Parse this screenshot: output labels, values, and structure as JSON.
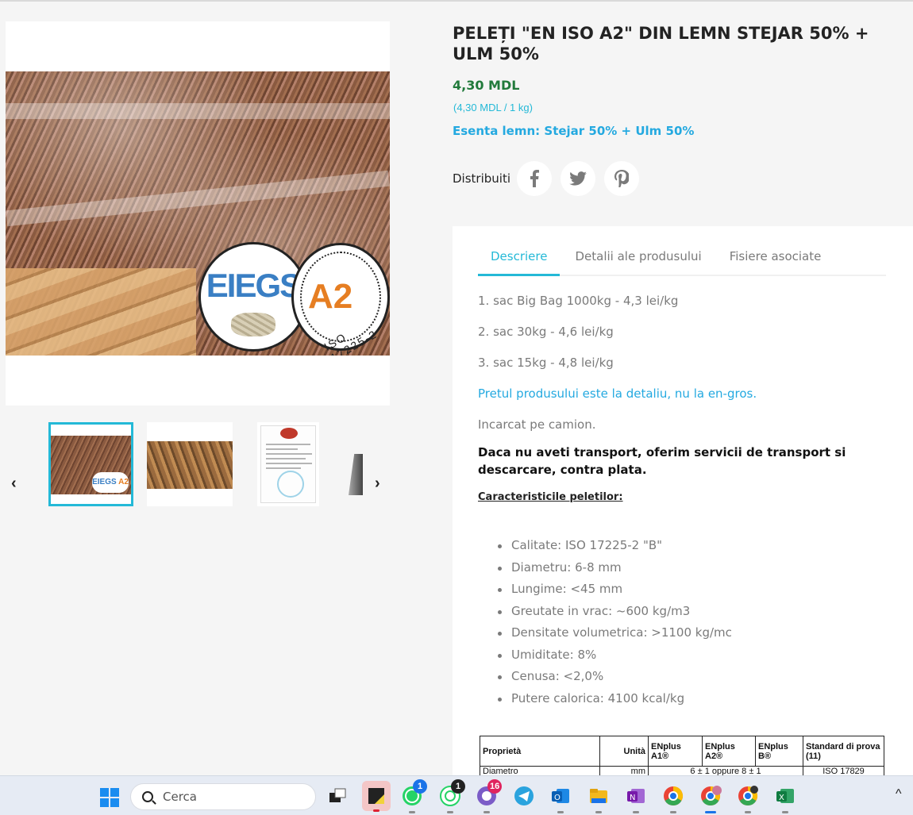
{
  "product": {
    "title": "PELEȚI \"EN ISO A2\" DIN LEMN STEJAR 50% + ULM 50%",
    "price": "4,30 MDL",
    "unit_price": "(4,30 MDL / 1 kg)",
    "wood_essence": "Esenta lemn: Stejar 50% + Ulm 50%"
  },
  "image": {
    "seal_left_text": "EIEGS",
    "seal_right_text": "A2",
    "seal_right_iso": "ISO 17225-2",
    "thumb_seal_left": "EIEGS",
    "thumb_seal_right": "A2"
  },
  "share": {
    "label": "Distribuiti",
    "icons": [
      "facebook-icon",
      "twitter-icon",
      "pinterest-icon"
    ]
  },
  "tabs": [
    {
      "label": "Descriere",
      "active": true
    },
    {
      "label": "Detalii ale produsului",
      "active": false
    },
    {
      "label": "Fisiere asociate",
      "active": false
    }
  ],
  "description": {
    "lines": [
      "1. sac Big Bag 1000kg - 4,3 lei/kg",
      "2. sac 30kg - 4,6 lei/kg",
      "3. sac 15kg - 4,8 lei/kg"
    ],
    "retail_note": "Pretul produsului este la detaliu, nu la en-gros.",
    "loaded_note": "Incarcat pe camion.",
    "transport_note": "Daca nu aveti transport, oferim servicii de transport si descarcare, contra plata.",
    "characteristics_title": "Caracteristicile peletilor:",
    "characteristics": [
      "Calitate: ISO 17225-2 \"B\"",
      "Diametru: 6-8 mm",
      "Lungime: <45 mm",
      "Greutate in vrac: ~600 kg/m3",
      "Densitate volumetrica: >1100 kg/mc",
      "Umiditate: 8%",
      "Cenusa: <2,0%",
      "Putere calorica: 4100 kcal/kg"
    ]
  },
  "table": {
    "headers": [
      "Proprietà",
      "Unità",
      "ENplus A1®",
      "ENplus A2®",
      "ENplus B®",
      "Standard di prova (11)"
    ],
    "row1": [
      "Diametro",
      "mm",
      "6 ± 1 oppure 8 ± 1",
      "ISO 17829"
    ]
  },
  "taskbar": {
    "search_placeholder": "Cerca",
    "badges": {
      "whatsapp": "1",
      "whatsapp_beta": "1",
      "viber": "16"
    }
  },
  "colors": {
    "accent": "#24b9d7",
    "price_green": "#217a3b",
    "link_blue": "#24a9e0"
  }
}
